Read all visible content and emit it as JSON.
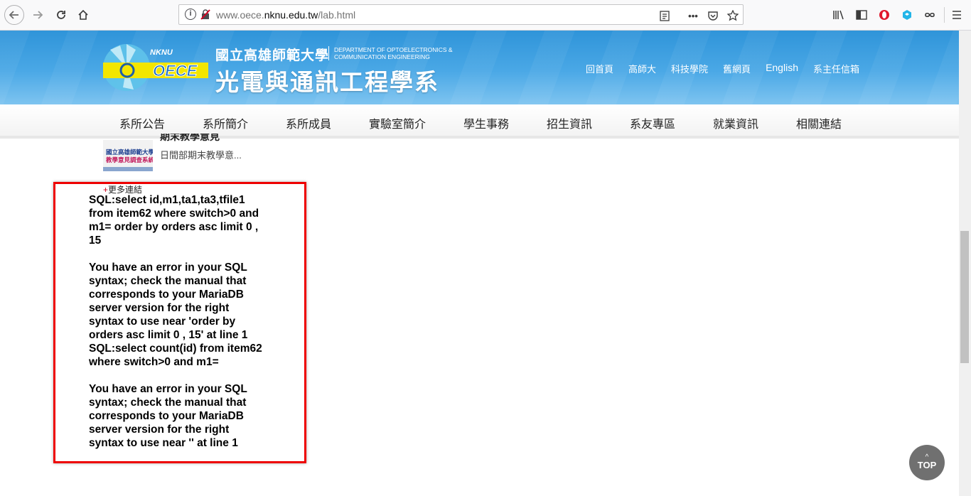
{
  "browser": {
    "url_prefix": "www.oece.",
    "url_domain": "nknu.edu.tw",
    "url_path": "/lab.html",
    "more_icon": "•••"
  },
  "header": {
    "logo_top": "NKNU",
    "logo_main": "OECE",
    "university": "國立高雄師範大學",
    "dept_en_line1": "DEPARTMENT OF OPTOELECTRONICS &",
    "dept_en_line2": "COMMUNICATION ENGINEERING",
    "dept_zh": "光電與通訊工程學系",
    "links": [
      "回首頁",
      "高師大",
      "科技學院",
      "舊網頁",
      "English",
      "系主任信箱"
    ]
  },
  "nav": {
    "items": [
      "系所公告",
      "系所簡介",
      "系所成員",
      "實驗室簡介",
      "學生事務",
      "招生資訊",
      "系友專區",
      "就業資訊",
      "相關連結"
    ]
  },
  "sidebar": {
    "thumb_line1": "國立高雄師範大學",
    "thumb_line2": "教學意見調查系統",
    "item_title": "期末教學意見",
    "item_desc": "日間部期末教學意...",
    "more_plus": "+",
    "more_label": "更多連結"
  },
  "error": {
    "text": "SQL:select id,m1,ta1,ta3,tfile1 from item62 where switch>0 and m1= order by orders asc limit 0 , 15\n\nYou have an error in your SQL syntax; check the manual that corresponds to your MariaDB server version for the right syntax to use near 'order by orders asc limit 0 , 15' at line 1\nSQL:select count(id) from item62 where switch>0 and m1=\n\nYou have an error in your SQL syntax; check the manual that corresponds to your MariaDB server version for the right syntax to use near '' at line 1"
  },
  "top_button": {
    "arrow": "^",
    "label": "TOP"
  }
}
